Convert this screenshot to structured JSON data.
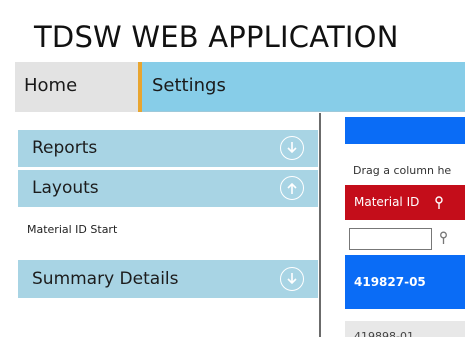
{
  "app": {
    "title": "TDSW WEB APPLICATION"
  },
  "nav": {
    "tabs": [
      {
        "label": "Home"
      },
      {
        "label": "Settings"
      }
    ]
  },
  "sidebar": {
    "panels": [
      {
        "label": "Reports",
        "icon": "circle-arrow-down-icon"
      },
      {
        "label": "Layouts",
        "icon": "circle-arrow-up-icon",
        "items": [
          {
            "label": "Material ID Start"
          }
        ]
      },
      {
        "label": "Summary Details",
        "icon": "circle-arrow-down-icon"
      }
    ]
  },
  "grid": {
    "drag_hint": "Drag a column he",
    "columns": [
      {
        "label": "Material ID"
      }
    ],
    "filter": {
      "value": ""
    },
    "rows": [
      {
        "material_id": "419827-05",
        "selected": true
      },
      {
        "material_id": "419898-01",
        "selected": false
      }
    ]
  },
  "colors": {
    "nav_bg": "#87cde8",
    "panel_bg": "#a8d4e4",
    "accent": "#e8a530",
    "header_red": "#c40d1a",
    "selected_blue": "#0a6cf6"
  }
}
